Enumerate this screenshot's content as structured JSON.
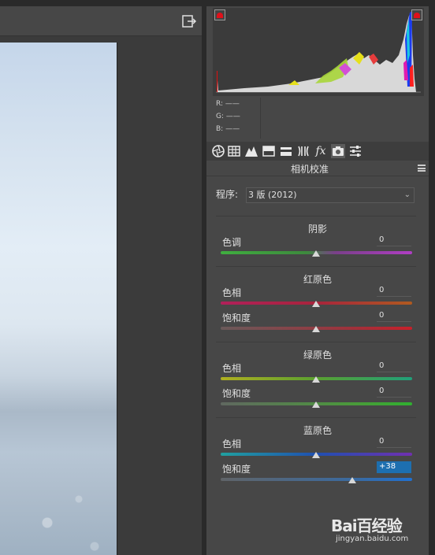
{
  "preview": {
    "exit_icon": "exit-icon"
  },
  "histogram": {
    "clip_shadow_icon": "shadow-clipping-icon",
    "clip_highlight_icon": "highlight-clipping-icon"
  },
  "rgb": {
    "r": "R: ——",
    "g": "G: ——",
    "b": "B: ——"
  },
  "tools": [
    "aperture-icon",
    "grid-icon",
    "mountain-icon",
    "split-top-icon",
    "split-bottom-icon",
    "lens-icon",
    "fx-icon",
    "camera-icon",
    "sliders-icon"
  ],
  "tool_labels": {
    "fx": "fx"
  },
  "panel": {
    "title": "相机校准",
    "process_label": "程序:",
    "process_value": "3 版 (2012)"
  },
  "shadows": {
    "title": "阴影",
    "tint_label": "色调",
    "tint_value": "0"
  },
  "red": {
    "title": "红原色",
    "hue_label": "色相",
    "hue_value": "0",
    "sat_label": "饱和度",
    "sat_value": "0"
  },
  "green": {
    "title": "绿原色",
    "hue_label": "色相",
    "hue_value": "0",
    "sat_label": "饱和度",
    "sat_value": "0"
  },
  "blue": {
    "title": "蓝原色",
    "hue_label": "色相",
    "hue_value": "0",
    "sat_label": "饱和度",
    "sat_value": "+38"
  },
  "watermark": {
    "main": "Bai百经验",
    "sub": "jingyan.baidu.com"
  }
}
